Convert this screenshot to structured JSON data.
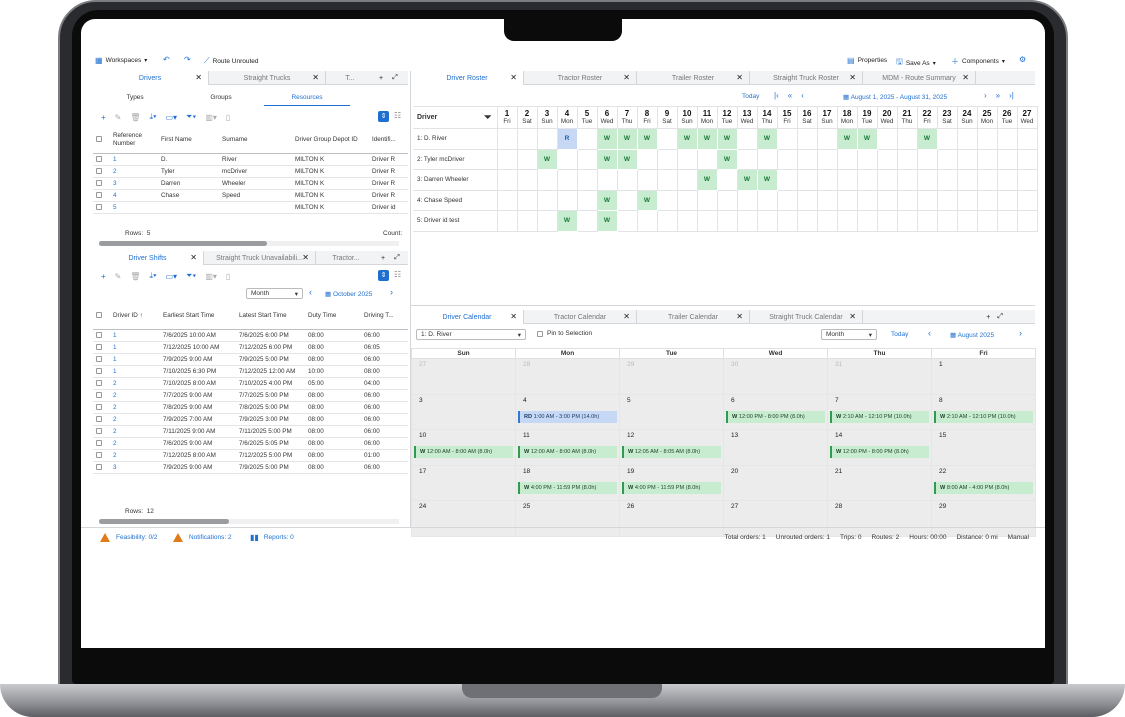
{
  "toolbar": {
    "workspaces": "Workspaces",
    "route_unrouted": "Route Unrouted",
    "properties": "Properties",
    "save_as": "Save As",
    "components": "Components"
  },
  "left_top": {
    "tabs": [
      "Drivers",
      "Straight Trucks",
      "T..."
    ],
    "subtabs": [
      "Types",
      "Groups",
      "Resources"
    ],
    "columns": [
      "Reference Number",
      "First Name",
      "Surname",
      "Driver Group Depot ID",
      "Identifi..."
    ],
    "rows": [
      {
        "ref": "1",
        "first": "D.",
        "surname": "River",
        "depot": "MILTON K",
        "ident": "Driver R"
      },
      {
        "ref": "2",
        "first": "Tyler",
        "surname": "mcDriver",
        "depot": "MILTON K",
        "ident": "Driver R"
      },
      {
        "ref": "3",
        "first": "Darren",
        "surname": "Wheeler",
        "depot": "MILTON K",
        "ident": "Driver R"
      },
      {
        "ref": "4",
        "first": "Chase",
        "surname": "Speed",
        "depot": "MILTON K",
        "ident": "Driver R"
      },
      {
        "ref": "5",
        "first": "",
        "surname": "",
        "depot": "MILTON K",
        "ident": "Driver id"
      }
    ],
    "rows_label": "Rows:",
    "rows_count": "5",
    "count_label": "Count:"
  },
  "left_bottom": {
    "tabs": [
      "Driver Shifts",
      "Straight Truck Unavailabili...",
      "Tractor..."
    ],
    "period": "Month",
    "month": "October 2025",
    "columns": [
      "Driver ID",
      "Earliest Start Time",
      "Latest Start Time",
      "Duty Time",
      "Driving T..."
    ],
    "rows": [
      {
        "id": "1",
        "earliest": "7/6/2025 10:00 AM",
        "latest": "7/6/2025 6:00 PM",
        "duty": "08:00",
        "drive": "06:00"
      },
      {
        "id": "1",
        "earliest": "7/12/2025 10:00 AM",
        "latest": "7/12/2025 6:00 PM",
        "duty": "08:00",
        "drive": "06:05"
      },
      {
        "id": "1",
        "earliest": "7/9/2025 9:00 AM",
        "latest": "7/9/2025 5:00 PM",
        "duty": "08:00",
        "drive": "06:00"
      },
      {
        "id": "1",
        "earliest": "7/10/2025 6:30 PM",
        "latest": "7/12/2025 12:00 AM",
        "duty": "10:00",
        "drive": "08:00"
      },
      {
        "id": "2",
        "earliest": "7/10/2025 8:00 AM",
        "latest": "7/10/2025 4:00 PM",
        "duty": "05:00",
        "drive": "04:00"
      },
      {
        "id": "2",
        "earliest": "7/7/2025 9:00 AM",
        "latest": "7/7/2025 5:00 PM",
        "duty": "08:00",
        "drive": "06:00"
      },
      {
        "id": "2",
        "earliest": "7/8/2025 9:00 AM",
        "latest": "7/8/2025 5:00 PM",
        "duty": "08:00",
        "drive": "06:00"
      },
      {
        "id": "2",
        "earliest": "7/9/2025 7:00 AM",
        "latest": "7/9/2025 3:00 PM",
        "duty": "08:00",
        "drive": "06:00"
      },
      {
        "id": "2",
        "earliest": "7/11/2025 9:00 AM",
        "latest": "7/11/2025 5:00 PM",
        "duty": "08:00",
        "drive": "06:00"
      },
      {
        "id": "2",
        "earliest": "7/6/2025 9:00 AM",
        "latest": "7/6/2025 5:05 PM",
        "duty": "08:00",
        "drive": "06:00"
      },
      {
        "id": "2",
        "earliest": "7/12/2025 8:00 AM",
        "latest": "7/12/2025 5:00 PM",
        "duty": "08:00",
        "drive": "01:00"
      },
      {
        "id": "3",
        "earliest": "7/9/2025 9:00 AM",
        "latest": "7/9/2025 5:00 PM",
        "duty": "08:00",
        "drive": "06:00"
      }
    ],
    "rows_label": "Rows:",
    "rows_count": "12"
  },
  "roster": {
    "tabs": [
      "Driver Roster",
      "Tractor Roster",
      "Trailer Roster",
      "Straight Truck Roster",
      "MDM - Route Summary"
    ],
    "today": "Today",
    "range": "August 1, 2025 - August 31, 2025",
    "driver_header": "Driver",
    "days": [
      [
        "1",
        "Fri"
      ],
      [
        "2",
        "Sat"
      ],
      [
        "3",
        "Sun"
      ],
      [
        "4",
        "Mon"
      ],
      [
        "5",
        "Tue"
      ],
      [
        "6",
        "Wed"
      ],
      [
        "7",
        "Thu"
      ],
      [
        "8",
        "Fri"
      ],
      [
        "9",
        "Sat"
      ],
      [
        "10",
        "Sun"
      ],
      [
        "11",
        "Mon"
      ],
      [
        "12",
        "Tue"
      ],
      [
        "13",
        "Wed"
      ],
      [
        "14",
        "Thu"
      ],
      [
        "15",
        "Fri"
      ],
      [
        "16",
        "Sat"
      ],
      [
        "17",
        "Sun"
      ],
      [
        "18",
        "Mon"
      ],
      [
        "19",
        "Tue"
      ],
      [
        "20",
        "Wed"
      ],
      [
        "21",
        "Thu"
      ],
      [
        "22",
        "Fri"
      ],
      [
        "23",
        "Sat"
      ],
      [
        "24",
        "Sun"
      ],
      [
        "25",
        "Mon"
      ],
      [
        "26",
        "Tue"
      ],
      [
        "27",
        "Wed"
      ]
    ],
    "drivers": [
      {
        "name": "1: D. River",
        "cells": {
          "4": "R",
          "6": "W",
          "7": "W",
          "8": "W",
          "10": "W",
          "11": "W",
          "12": "W",
          "14": "W",
          "18": "W",
          "19": "W",
          "22": "W"
        }
      },
      {
        "name": "2: Tyler mcDriver",
        "cells": {
          "3": "W",
          "6": "W",
          "7": "W",
          "12": "W"
        }
      },
      {
        "name": "3: Darren Wheeler",
        "cells": {
          "11": "W",
          "13": "W",
          "14": "W"
        }
      },
      {
        "name": "4: Chase Speed",
        "cells": {
          "6": "W",
          "8": "W"
        }
      },
      {
        "name": "5: Driver id test",
        "cells": {
          "4": "W",
          "6": "W"
        }
      }
    ]
  },
  "calendar": {
    "tabs": [
      "Driver Calendar",
      "Tractor Calendar",
      "Trailer Calendar",
      "Straight Truck Calendar"
    ],
    "driver_select": "1: D. River",
    "pin_label": "Pin to Selection",
    "period": "Month",
    "today": "Today",
    "month": "August 2025",
    "weekdays": [
      "Sun",
      "Mon",
      "Tue",
      "Wed",
      "Thu",
      "Fri"
    ],
    "weeks": [
      [
        {
          "d": "27",
          "pad": true
        },
        {
          "d": "28",
          "pad": true
        },
        {
          "d": "29",
          "pad": true
        },
        {
          "d": "30",
          "pad": true
        },
        {
          "d": "31",
          "pad": true
        },
        {
          "d": "1"
        }
      ],
      [
        {
          "d": "3"
        },
        {
          "d": "4",
          "ev": {
            "t": "RD",
            "txt": "1:00 AM - 3:00 PM (14.0h)"
          }
        },
        {
          "d": "5"
        },
        {
          "d": "6",
          "ev": {
            "t": "W",
            "txt": "12:00 PM - 8:00 PM (8.0h)"
          }
        },
        {
          "d": "7",
          "ev": {
            "t": "W",
            "txt": "2:10 AM - 12:10 PM (10.0h)"
          }
        },
        {
          "d": "8",
          "ev": {
            "t": "W",
            "txt": "2:10 AM - 12:10 PM (10.0h)"
          }
        }
      ],
      [
        {
          "d": "10",
          "ev": {
            "t": "W",
            "txt": "12:00 AM - 8:00 AM (8.0h)"
          }
        },
        {
          "d": "11",
          "ev": {
            "t": "W",
            "txt": "12:00 AM - 8:00 AM (8.0h)"
          }
        },
        {
          "d": "12",
          "ev": {
            "t": "W",
            "txt": "12:05 AM - 8:05 AM (8.0h)"
          }
        },
        {
          "d": "13"
        },
        {
          "d": "14",
          "ev": {
            "t": "W",
            "txt": "12:00 PM - 8:00 PM (8.0h)"
          }
        },
        {
          "d": "15"
        }
      ],
      [
        {
          "d": "17"
        },
        {
          "d": "18",
          "ev": {
            "t": "W",
            "txt": "4:00 PM - 11:59 PM (8.0h)"
          }
        },
        {
          "d": "19",
          "ev": {
            "t": "W",
            "txt": "4:00 PM - 11:59 PM (8.0h)"
          }
        },
        {
          "d": "20"
        },
        {
          "d": "21"
        },
        {
          "d": "22",
          "ev": {
            "t": "W",
            "txt": "8:00 AM - 4:00 PM (8.0h)"
          }
        }
      ],
      [
        {
          "d": "24"
        },
        {
          "d": "25"
        },
        {
          "d": "26"
        },
        {
          "d": "27"
        },
        {
          "d": "28"
        },
        {
          "d": "29"
        }
      ]
    ]
  },
  "status": {
    "feasibility": "Feasibility: 0/2",
    "notifications": "Notifications: 2",
    "reports": "Reports: 0",
    "total_orders": "Total orders: 1",
    "unrouted": "Unrouted orders: 1",
    "trips": "Trips: 0",
    "routes": "Routes: 2",
    "hours": "Hours: 00:00",
    "distance": "Distance: 0 mi",
    "mode": "Manual"
  }
}
